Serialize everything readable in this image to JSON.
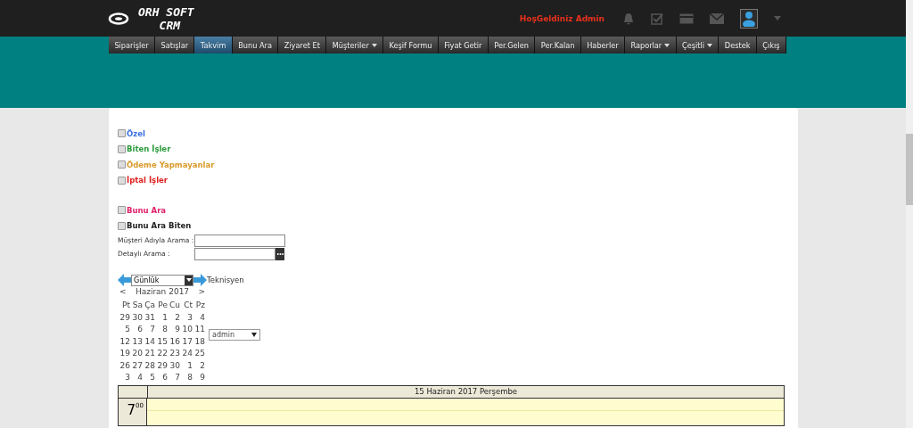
{
  "logo": {
    "line1": "ORH SOFT",
    "line2": "CRM"
  },
  "header": {
    "greeting": "HoşGeldiniz Admin"
  },
  "nav": [
    {
      "label": "Siparişler",
      "selected": false,
      "dropdown": false
    },
    {
      "label": "Satışlar",
      "selected": false,
      "dropdown": false
    },
    {
      "label": "Takvim",
      "selected": true,
      "dropdown": false
    },
    {
      "label": "Bunu Ara",
      "selected": false,
      "dropdown": false
    },
    {
      "label": "Ziyaret Et",
      "selected": false,
      "dropdown": false
    },
    {
      "label": "Müşteriler",
      "selected": false,
      "dropdown": true
    },
    {
      "label": "Keşif Formu",
      "selected": false,
      "dropdown": false
    },
    {
      "label": "Fiyat Getir",
      "selected": false,
      "dropdown": false
    },
    {
      "label": "Per.Gelen",
      "selected": false,
      "dropdown": false
    },
    {
      "label": "Per.Kalan",
      "selected": false,
      "dropdown": false
    },
    {
      "label": "Haberler",
      "selected": false,
      "dropdown": false
    },
    {
      "label": "Raporlar",
      "selected": false,
      "dropdown": true
    },
    {
      "label": "Çeşitli",
      "selected": false,
      "dropdown": true
    },
    {
      "label": "Destek",
      "selected": false,
      "dropdown": false
    },
    {
      "label": "Çıkış",
      "selected": false,
      "dropdown": false
    }
  ],
  "filters": [
    {
      "label": "Özel",
      "checked": false,
      "color": "#3a6fe0"
    },
    {
      "label": "Biten İşler",
      "checked": false,
      "color": "#2a9a3a"
    },
    {
      "label": "Ödeme Yapmayanlar",
      "checked": false,
      "color": "#d99a2a"
    },
    {
      "label": "İptal İşler",
      "checked": false,
      "color": "#e02020"
    }
  ],
  "filters2": [
    {
      "label": "Bunu Ara",
      "checked": false,
      "color": "#e0206a"
    },
    {
      "label": "Bunu Ara Biten",
      "checked": false,
      "color": "#222222"
    }
  ],
  "search": [
    {
      "label": "Müşteri Adıyla Arama :",
      "button": false
    },
    {
      "label": "Detaylı Arama :",
      "button": true
    }
  ],
  "view": {
    "value": "Günlük",
    "technician_label": "Teknisyen",
    "user": "admin"
  },
  "minical": {
    "prev": "<",
    "title": "Haziran 2017",
    "next": ">",
    "weekdays": [
      "Pt",
      "Sa",
      "Ça",
      "Pe",
      "Cu",
      "Ct",
      "Pz"
    ],
    "weeks": [
      [
        "29",
        "30",
        "31",
        "1",
        "2",
        "3",
        "4"
      ],
      [
        "5",
        "6",
        "7",
        "8",
        "9",
        "10",
        "11"
      ],
      [
        "12",
        "13",
        "14",
        "15",
        "16",
        "17",
        "18"
      ],
      [
        "19",
        "20",
        "21",
        "22",
        "23",
        "24",
        "25"
      ],
      [
        "26",
        "27",
        "28",
        "29",
        "30",
        "1",
        "2"
      ],
      [
        "3",
        "4",
        "5",
        "6",
        "7",
        "8",
        "9"
      ]
    ]
  },
  "day": {
    "title": "15 Haziran 2017 Perşembe",
    "hour": "7",
    "minutes": "00"
  }
}
